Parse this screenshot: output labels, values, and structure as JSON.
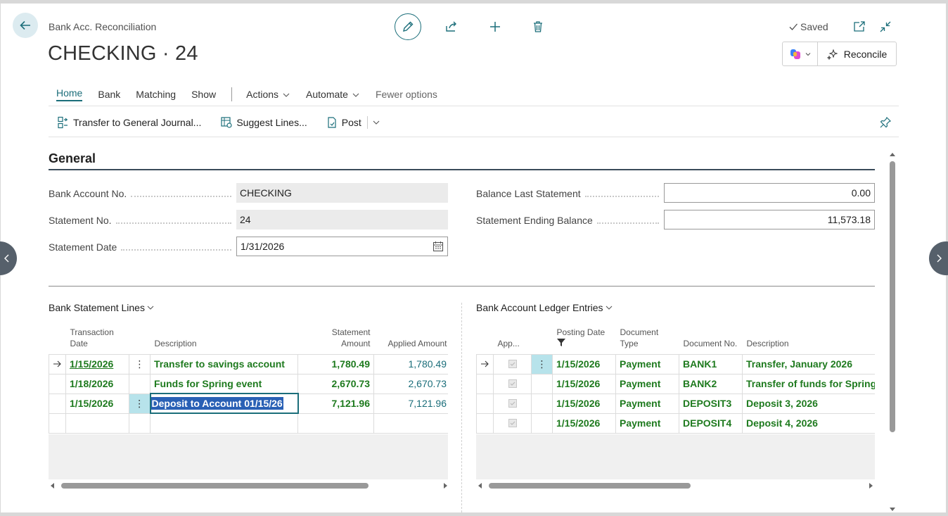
{
  "header": {
    "breadcrumb": "Bank Acc. Reconciliation",
    "title": "CHECKING · 24",
    "saved_label": "Saved",
    "reconcile_label": "Reconcile"
  },
  "nav": {
    "tabs": [
      "Home",
      "Bank",
      "Matching",
      "Show"
    ],
    "actions": "Actions",
    "automate": "Automate",
    "fewer": "Fewer options"
  },
  "actionbar": {
    "transfer": "Transfer to General Journal...",
    "suggest": "Suggest Lines...",
    "post": "Post"
  },
  "general": {
    "title": "General",
    "fields_left": [
      {
        "label": "Bank Account No.",
        "value": "CHECKING"
      },
      {
        "label": "Statement No.",
        "value": "24"
      },
      {
        "label": "Statement Date",
        "value": "1/31/2026"
      }
    ],
    "fields_right": [
      {
        "label": "Balance Last Statement",
        "value": "0.00"
      },
      {
        "label": "Statement Ending Balance",
        "value": "11,573.18"
      }
    ]
  },
  "statement_lines": {
    "title": "Bank Statement Lines",
    "headers": {
      "date": "Transaction Date",
      "description": "Description",
      "amount": "Statement Amount",
      "applied": "Applied Amount"
    },
    "rows": [
      {
        "date": "1/15/2026",
        "description": "Transfer to savings account",
        "amount": "1,780.49",
        "applied": "1,780.49"
      },
      {
        "date": "1/18/2026",
        "description": "Funds for Spring event",
        "amount": "2,670.73",
        "applied": "2,670.73"
      },
      {
        "date": "1/15/2026",
        "description": "Deposit to Account 01/15/26",
        "amount": "7,121.96",
        "applied": "7,121.96"
      }
    ]
  },
  "ledger_entries": {
    "title": "Bank Account Ledger Entries",
    "headers": {
      "applied": "App...",
      "posting_date": "Posting Date",
      "doc_type": "Document Type",
      "doc_no": "Document No.",
      "description": "Description"
    },
    "rows": [
      {
        "posting_date": "1/15/2026",
        "doc_type": "Payment",
        "doc_no": "BANK1",
        "description": "Transfer, January 2026"
      },
      {
        "posting_date": "1/15/2026",
        "doc_type": "Payment",
        "doc_no": "BANK2",
        "description": "Transfer of funds for Spring"
      },
      {
        "posting_date": "1/15/2026",
        "doc_type": "Payment",
        "doc_no": "DEPOSIT3",
        "description": "Deposit 3, 2026"
      },
      {
        "posting_date": "1/15/2026",
        "doc_type": "Payment",
        "doc_no": "DEPOSIT4",
        "description": "Deposit 4, 2026"
      }
    ]
  },
  "colors": {
    "accent": "#1b6e7a",
    "data_green": "#1e7a1e",
    "selection": "#b7e3eb"
  },
  "icons": [
    "back-arrow-icon",
    "pencil-icon",
    "share-icon",
    "plus-icon",
    "trash-icon",
    "check-icon",
    "open-new-window-icon",
    "collapse-icon",
    "copilot-icon",
    "sparkle-icon",
    "pin-icon",
    "calendar-icon",
    "filter-icon"
  ]
}
